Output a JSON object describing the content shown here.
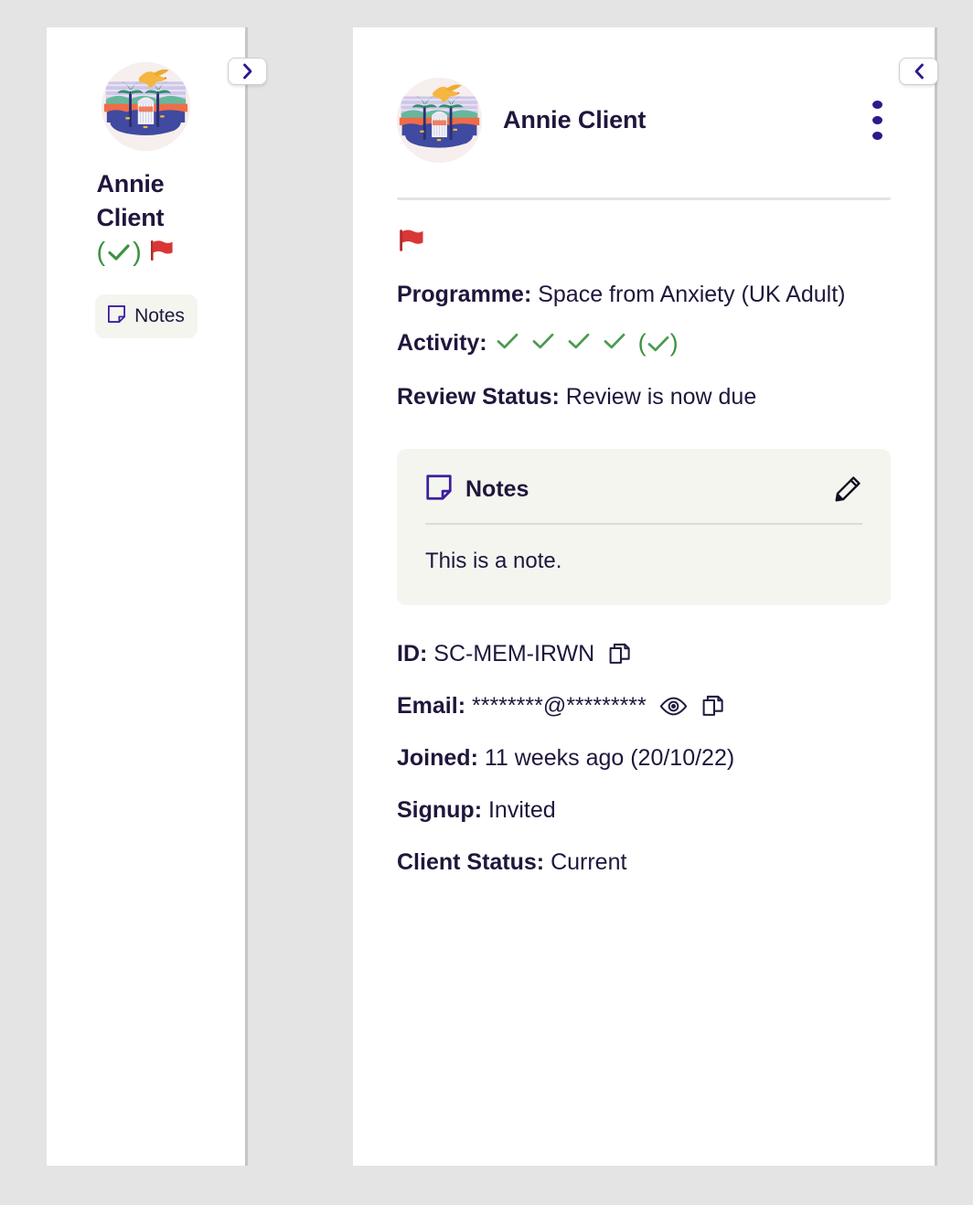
{
  "theme": {
    "page_bg": "#e4e4e4",
    "panel_bg": "#ffffff",
    "text": "#20163c",
    "accent_purple": "#2b1a8c",
    "green": "#3f9142",
    "flag_red": "#d93636",
    "card_bg": "#f5f5f0",
    "divider": "#c6c6c6"
  },
  "sidebar": {
    "avatar_icon": "client-avatar-illustration",
    "name": "Annie Client",
    "badges": {
      "paren_check_icon": "green-parenthesised-check-icon",
      "flag_icon": "red-flag-icon"
    },
    "notes_chip": {
      "icon": "notes-icon",
      "label": "Notes"
    }
  },
  "toggles": {
    "expand_sidebar_icon": "chevron-right-icon",
    "collapse_panel_icon": "chevron-left-icon"
  },
  "main": {
    "header": {
      "avatar_icon": "client-avatar-illustration",
      "name": "Annie Client",
      "menu_icon": "kebab-menu-icon"
    },
    "flag": {
      "icon": "red-flag-icon"
    },
    "fields": {
      "programme": {
        "label": "Programme:",
        "value": "Space from Anxiety (UK Adult)"
      },
      "activity": {
        "label": "Activity:",
        "check_count": 4,
        "paren_check_icon": "green-parenthesised-check-icon"
      },
      "review_status": {
        "label": "Review Status:",
        "value": "Review is now due"
      }
    },
    "notes_card": {
      "icon": "notes-icon",
      "title": "Notes",
      "edit_icon": "pencil-edit-icon",
      "body": "This is a note."
    },
    "details": [
      {
        "label": "ID:",
        "value": "SC-MEM-IRWN",
        "icons": [
          "copy-icon"
        ]
      },
      {
        "label": "Email:",
        "value": "********@*********",
        "icons": [
          "eye-reveal-icon",
          "copy-icon"
        ]
      },
      {
        "label": "Joined:",
        "value": "11 weeks ago (20/10/22)",
        "icons": []
      },
      {
        "label": "Signup:",
        "value": "Invited",
        "icons": []
      },
      {
        "label": "Client Status:",
        "value": "Current",
        "icons": []
      }
    ]
  }
}
